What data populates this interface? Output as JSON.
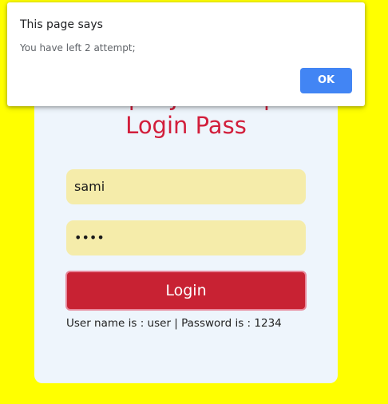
{
  "card": {
    "title_line1": "Simple JavaScript",
    "title_line2": "Login Pass",
    "username_value": "sami",
    "password_value": "••••",
    "login_label": "Login",
    "hint": "User name is : user | Password is : 1234"
  },
  "dialog": {
    "title": "This page says",
    "message": "You have left 2 attempt;",
    "ok_label": "OK"
  },
  "colors": {
    "page_background": "#ffff00",
    "card_background": "#eef5fc",
    "title_color": "#d21f3c",
    "field_background": "#f5ecaa",
    "login_button": "#c82233",
    "ok_button": "#4285f4"
  }
}
